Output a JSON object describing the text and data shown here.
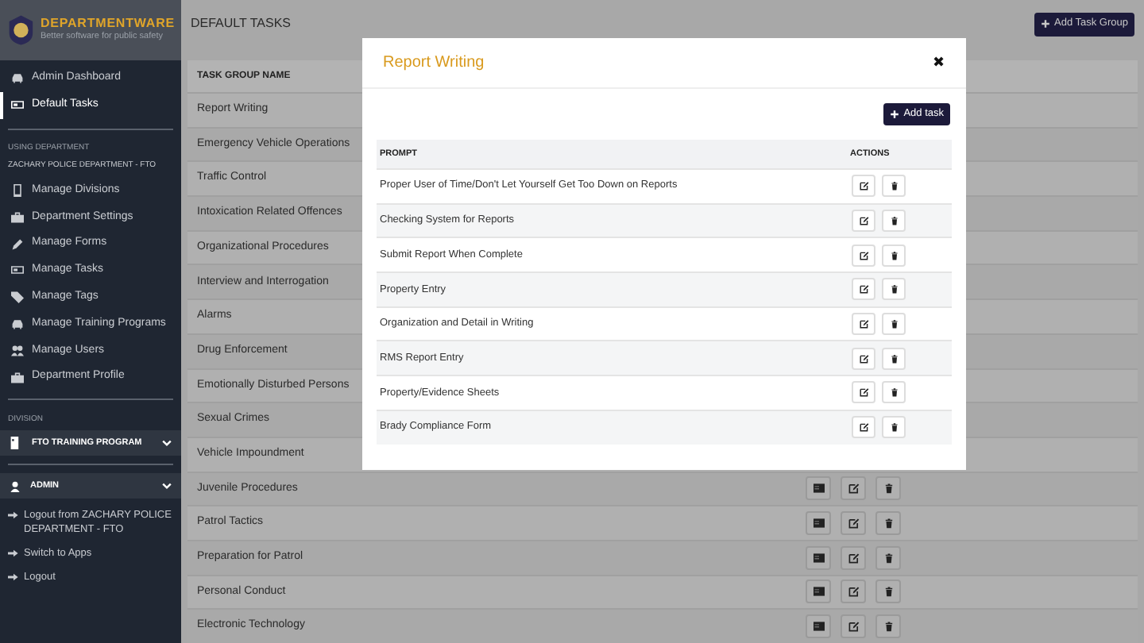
{
  "brand": {
    "name": "DEPARTMENTWARE",
    "tagline": "Better software for public safety"
  },
  "top_nav": [
    {
      "label": "Admin Dashboard",
      "selected": false
    },
    {
      "label": "Default Tasks",
      "selected": true
    }
  ],
  "department": {
    "label": "USING DEPARTMENT",
    "name": "ZACHARY POLICE DEPARTMENT - FTO"
  },
  "department_nav": [
    {
      "label": "Manage Divisions"
    },
    {
      "label": "Department Settings"
    },
    {
      "label": "Manage Forms"
    },
    {
      "label": "Manage Tasks"
    },
    {
      "label": "Manage Tags"
    },
    {
      "label": "Manage Training Programs"
    },
    {
      "label": "Manage Users"
    },
    {
      "label": "Department Profile"
    }
  ],
  "division": {
    "label": "DIVISION",
    "program": "FTO TRAINING PROGRAM"
  },
  "user": {
    "name": "ADMIN"
  },
  "account_links": [
    {
      "label": "Logout from ZACHARY POLICE DEPARTMENT - FTO"
    },
    {
      "label": "Switch to Apps"
    },
    {
      "label": "Logout"
    }
  ],
  "page": {
    "title": "DEFAULT TASKS",
    "add_button": "Add Task Group"
  },
  "table": {
    "column": "TASK GROUP NAME",
    "rows": [
      {
        "name": "Report Writing",
        "actions": false
      },
      {
        "name": "Emergency Vehicle Operations",
        "actions": false
      },
      {
        "name": "Traffic Control",
        "actions": false
      },
      {
        "name": "Intoxication Related Offences",
        "actions": false
      },
      {
        "name": "Organizational Procedures",
        "actions": false
      },
      {
        "name": "Interview and Interrogation",
        "actions": false
      },
      {
        "name": "Alarms",
        "actions": false
      },
      {
        "name": "Drug Enforcement",
        "actions": false
      },
      {
        "name": "Emotionally Disturbed Persons",
        "actions": false
      },
      {
        "name": "Sexual Crimes",
        "actions": false
      },
      {
        "name": "Vehicle Impoundment",
        "actions": false
      },
      {
        "name": "Juvenile Procedures",
        "actions": true
      },
      {
        "name": "Patrol Tactics",
        "actions": true
      },
      {
        "name": "Preparation for Patrol",
        "actions": true
      },
      {
        "name": "Personal Conduct",
        "actions": true
      },
      {
        "name": "Electronic Technology",
        "actions": true
      }
    ]
  },
  "modal": {
    "title": "Report Writing",
    "close": "✖",
    "add_button": "Add task",
    "columns": [
      "PROMPT",
      "ACTIONS"
    ],
    "rows": [
      "Proper User of Time/Don't Let Yourself Get Too Down on Reports",
      "Checking System for Reports",
      "Submit Report When Complete",
      "Property Entry",
      "Organization and Detail in Writing",
      "RMS Report Entry",
      "Property/Evidence Sheets",
      "Brady Compliance Form"
    ]
  }
}
